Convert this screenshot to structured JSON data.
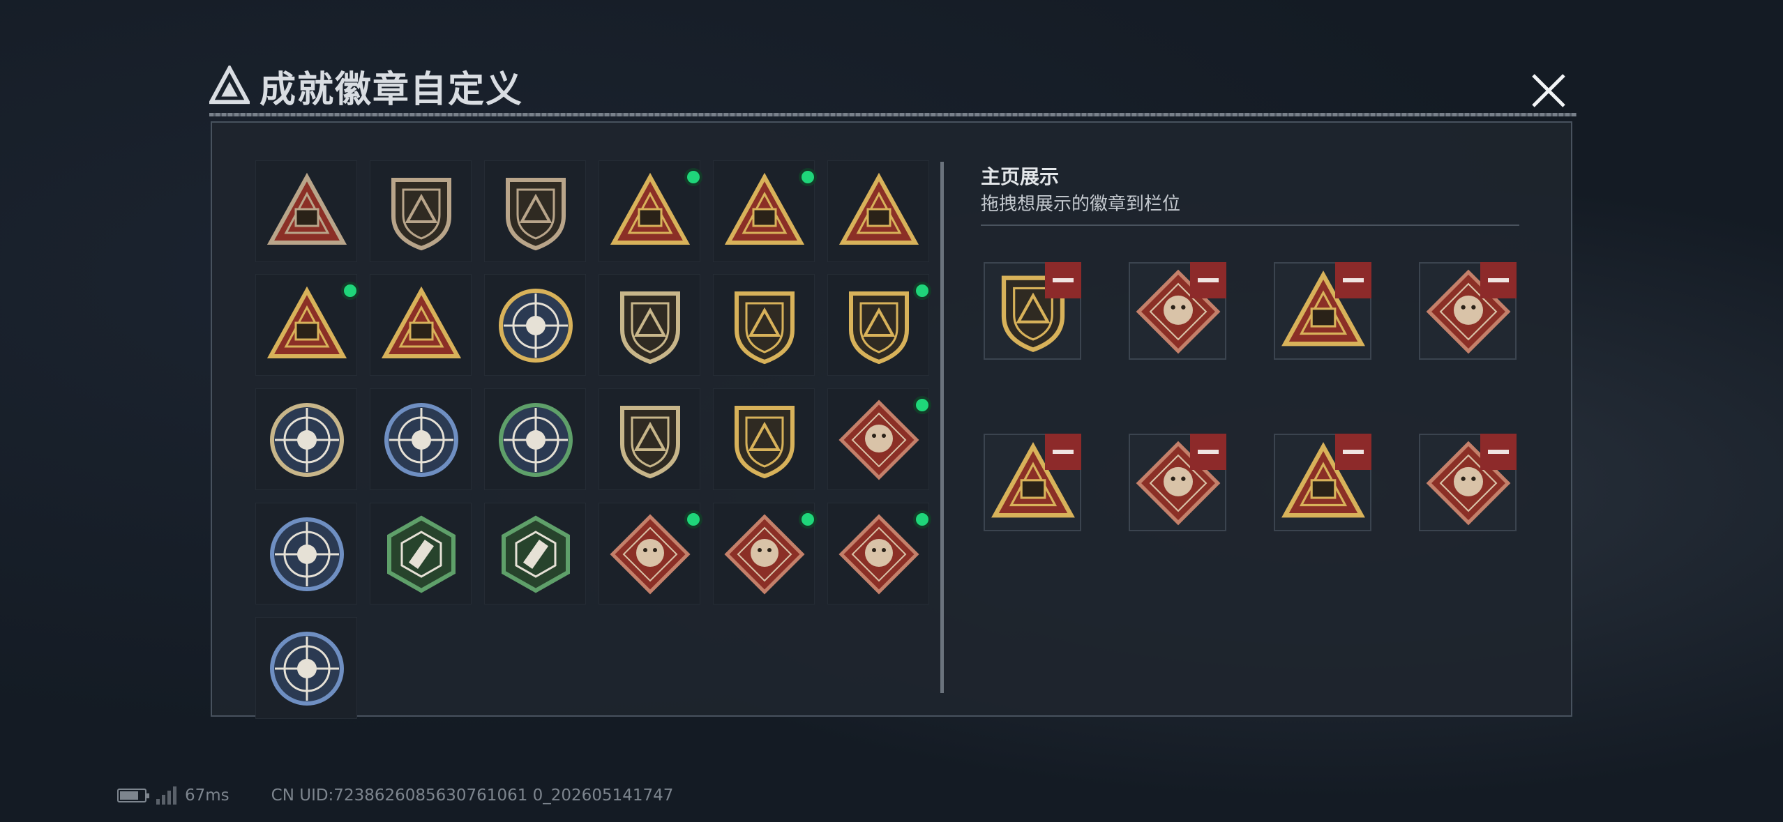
{
  "title": "成就徽章自定义",
  "right_panel": {
    "title": "主页展示",
    "subtitle": "拖拽想展示的徽章到栏位"
  },
  "badge_grid": [
    {
      "icon": "shield-triangle-emblem-badge",
      "color": "#b9a58a",
      "new": false
    },
    {
      "icon": "helicopter-shield-badge",
      "color": "#b9a58a",
      "new": false
    },
    {
      "icon": "diamond-shield-badge",
      "color": "#b9a58a",
      "new": false
    },
    {
      "icon": "s4-season-triangle-badge",
      "color": "#d8b25a",
      "new": true
    },
    {
      "icon": "s8-season-triangle-badge",
      "color": "#d8b25a",
      "new": true
    },
    {
      "icon": "number-one-triangle-badge",
      "color": "#d8b25a",
      "new": false
    },
    {
      "icon": "operator-triangle-badge",
      "color": "#d8b25a",
      "new": true
    },
    {
      "icon": "squad-triangle-badge",
      "color": "#d8b25a",
      "new": false
    },
    {
      "icon": "star-medal-badge",
      "color": "#d8b25a",
      "new": false
    },
    {
      "icon": "chevron-shield-badge",
      "color": "#c8b68a",
      "new": false
    },
    {
      "icon": "winged-shield-badge",
      "color": "#d8b25a",
      "new": false
    },
    {
      "icon": "gem-shield-badge",
      "color": "#d8b25a",
      "new": true
    },
    {
      "icon": "soldier-crosshair-badge",
      "color": "#c8b68a",
      "new": false
    },
    {
      "icon": "rifle-crosshair-blue-badge",
      "color": "#6f8fc2",
      "new": false
    },
    {
      "icon": "rifle-crosshair-green-badge",
      "color": "#5fa06a",
      "new": false
    },
    {
      "icon": "rifle-shield-badge",
      "color": "#c8b68a",
      "new": false
    },
    {
      "icon": "sniper-shield-badge",
      "color": "#d8b25a",
      "new": false
    },
    {
      "icon": "wolf-diamond-badge",
      "color": "#c4806a",
      "new": true
    },
    {
      "icon": "eagle-round-badge",
      "color": "#6f8fc2",
      "new": false
    },
    {
      "icon": "wasp-hexagon-badge",
      "color": "#5fa06a",
      "new": false
    },
    {
      "icon": "knife-hexagon-badge",
      "color": "#5fa06a",
      "new": false
    },
    {
      "icon": "dragon-diamond-badge",
      "color": "#c4806a",
      "new": true
    },
    {
      "icon": "dragon-diamond-badge",
      "color": "#c4806a",
      "new": true
    },
    {
      "icon": "runner-diamond-badge",
      "color": "#c4806a",
      "new": true
    },
    {
      "icon": "lynx-round-badge",
      "color": "#6f8fc2",
      "new": false
    }
  ],
  "showcase_slots": [
    {
      "icon": "gem-shield-badge"
    },
    {
      "icon": "dragon-diamond-badge"
    },
    {
      "icon": "s8-season-triangle-badge"
    },
    {
      "icon": "wolf-diamond-badge"
    },
    {
      "icon": "operator-triangle-badge"
    },
    {
      "icon": "dragon-diamond-badge"
    },
    {
      "icon": "s4-season-triangle-badge"
    },
    {
      "icon": "runner-diamond-badge"
    }
  ],
  "status_bar": {
    "ping": "67ms",
    "uid": "CN UID:7238626085630761061 0_202605141747"
  }
}
